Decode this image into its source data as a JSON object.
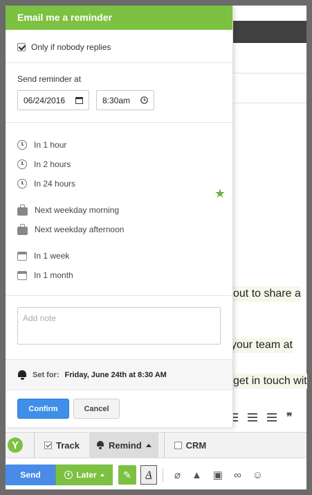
{
  "popup": {
    "title": "Email me a reminder",
    "only_if_nobody_replies": "Only if nobody replies",
    "send_reminder_at": "Send reminder at",
    "date_value": "06/24/2016",
    "time_value": "8:30am",
    "options": [
      {
        "label": "In 1 hour",
        "icon": "clock-icon"
      },
      {
        "label": "In 2 hours",
        "icon": "clock-icon"
      },
      {
        "label": "In 24 hours",
        "icon": "clock-icon"
      },
      {
        "label": "Next weekday morning",
        "icon": "briefcase-icon"
      },
      {
        "label": "Next weekday afternoon",
        "icon": "briefcase-icon"
      },
      {
        "label": "In 1 week",
        "icon": "calendar-icon"
      },
      {
        "label": "In 1 month",
        "icon": "calendar-icon"
      }
    ],
    "note_placeholder": "Add note",
    "set_for_label": "Set for:",
    "set_for_value": "Friday, June 24th at 8:30 AM",
    "confirm": "Confirm",
    "cancel": "Cancel"
  },
  "background": {
    "line1": "out to share a",
    "line2": "your team at",
    "line3": "get in touch wit"
  },
  "toolbar": {
    "track": "Track",
    "remind": "Remind",
    "crm": "CRM",
    "send": "Send",
    "later": "Later"
  },
  "colors": {
    "brand_green": "#7cc142",
    "confirm_blue": "#3d8fe7",
    "send_blue": "#4a8be8",
    "star_green": "#6cb33f"
  }
}
